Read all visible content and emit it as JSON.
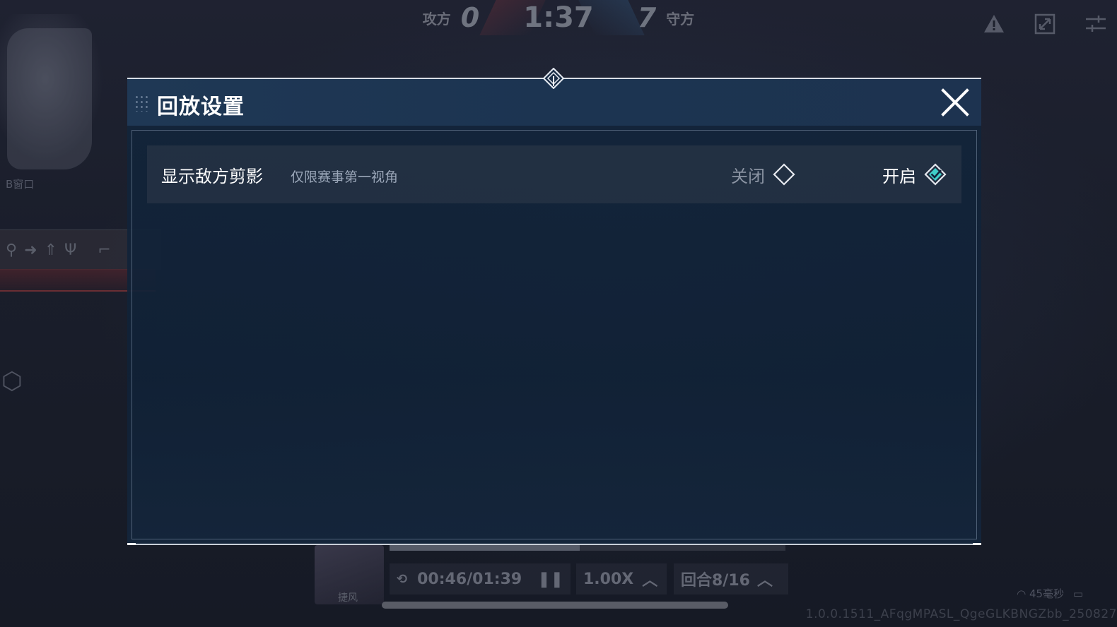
{
  "hud": {
    "attack_label": "攻方",
    "attack_score": "0",
    "timer": "1:37",
    "defend_score": "7",
    "defend_label": "守方",
    "minimap_label": "B窗口",
    "agent_name": "捷风",
    "replay_time": "00:46/01:39",
    "speed": "1.00X",
    "round": "回合8/16",
    "network": "45毫秒",
    "build_id": "1.0.0.1511_AFqgMPASL_QgeGLKBNGZbb_250827",
    "progress_fraction": 0.48
  },
  "modal": {
    "title": "回放设置",
    "setting": {
      "label": "显示敌方剪影",
      "hint": "仅限赛事第一视角",
      "off_label": "关闭",
      "on_label": "开启",
      "selected": "on"
    }
  },
  "colors": {
    "accent": "#3fd0c9",
    "header_bg": "#1f3855",
    "body_bg": "#12243a"
  },
  "icons": [
    "warning-icon",
    "fullscreen-icon",
    "settings-sliders-icon",
    "close-icon",
    "drag-handle-icon",
    "diamond-radio-icon",
    "pause-icon",
    "rewind-10s-icon",
    "chevron-up-icon"
  ]
}
